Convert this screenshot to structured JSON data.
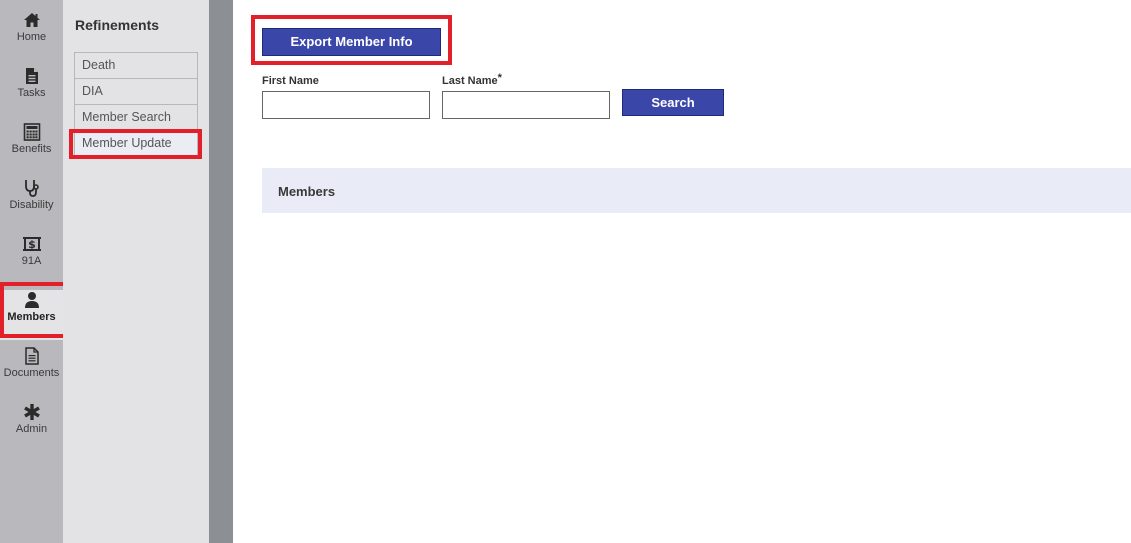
{
  "nav": {
    "items": [
      {
        "id": "home",
        "label": "Home",
        "icon": "home-icon"
      },
      {
        "id": "tasks",
        "label": "Tasks",
        "icon": "file-icon"
      },
      {
        "id": "benefits",
        "label": "Benefits",
        "icon": "calculator-icon"
      },
      {
        "id": "disability",
        "label": "Disability",
        "icon": "stethoscope-icon"
      },
      {
        "id": "91a",
        "label": "91A",
        "icon": "money-icon"
      },
      {
        "id": "members",
        "label": "Members",
        "icon": "user-icon",
        "active": true
      },
      {
        "id": "documents",
        "label": "Documents",
        "icon": "document-icon"
      },
      {
        "id": "admin",
        "label": "Admin",
        "icon": "asterisk-icon"
      }
    ]
  },
  "refinements": {
    "title": "Refinements",
    "items": [
      {
        "label": "Death"
      },
      {
        "label": "DIA"
      },
      {
        "label": "Member Search"
      },
      {
        "label": "Member Update",
        "active": true
      }
    ]
  },
  "main": {
    "export_button": "Export Member Info",
    "first_name_label": "First Name",
    "last_name_label": "Last Name",
    "required_mark": "*",
    "first_name_value": "",
    "last_name_value": "",
    "search_button": "Search",
    "members_section_title": "Members"
  },
  "colors": {
    "accent": "#3b47a8",
    "highlight": "#e3202a",
    "nav_bg": "#b9b9bd",
    "panel_bg": "#e3e3e5"
  }
}
